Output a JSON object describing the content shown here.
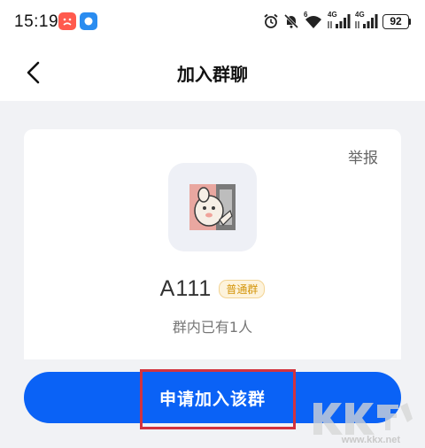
{
  "status_bar": {
    "time": "15:19",
    "signal_labels": [
      "6",
      "4G",
      "4G"
    ],
    "battery": "92"
  },
  "nav": {
    "title": "加入群聊"
  },
  "card": {
    "report_label": "举报",
    "group_name": "A111",
    "group_badge": "普通群",
    "member_count": "群内已有1人"
  },
  "join_button": {
    "label": "申请加入该群"
  },
  "watermark": {
    "url": "www.kkx.net",
    "logo_text": "KK下载"
  },
  "colors": {
    "primary": "#0a62f6",
    "highlight": "#d2333f",
    "badge_text": "#d4950b",
    "background": "#f1f2f5"
  },
  "icons": [
    "sad-face-app-icon",
    "blue-app-icon",
    "alarm-icon",
    "mute-bell-icon",
    "wifi-icon",
    "cell-signal-icon",
    "battery-icon",
    "back-arrow-icon"
  ]
}
